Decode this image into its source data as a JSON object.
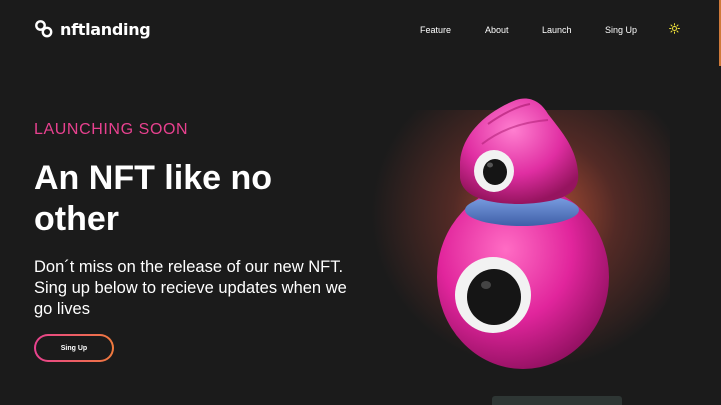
{
  "header": {
    "brand": "nftlanding",
    "nav": [
      "Feature",
      "About",
      "Launch",
      "Sing Up"
    ],
    "theme_icon": "sun-icon"
  },
  "hero": {
    "kicker": "LAUNCHING SOON",
    "headline": "An NFT like no other",
    "description": "Don´t miss on the release of our new NFT. Sing up below to recieve updates when we go lives",
    "cta_label": "Sing Up"
  },
  "colors": {
    "accent_pink": "#e8418f",
    "accent_orange": "#f07a3c",
    "background": "#1b1b1b",
    "theme_icon": "#f0e23a"
  }
}
